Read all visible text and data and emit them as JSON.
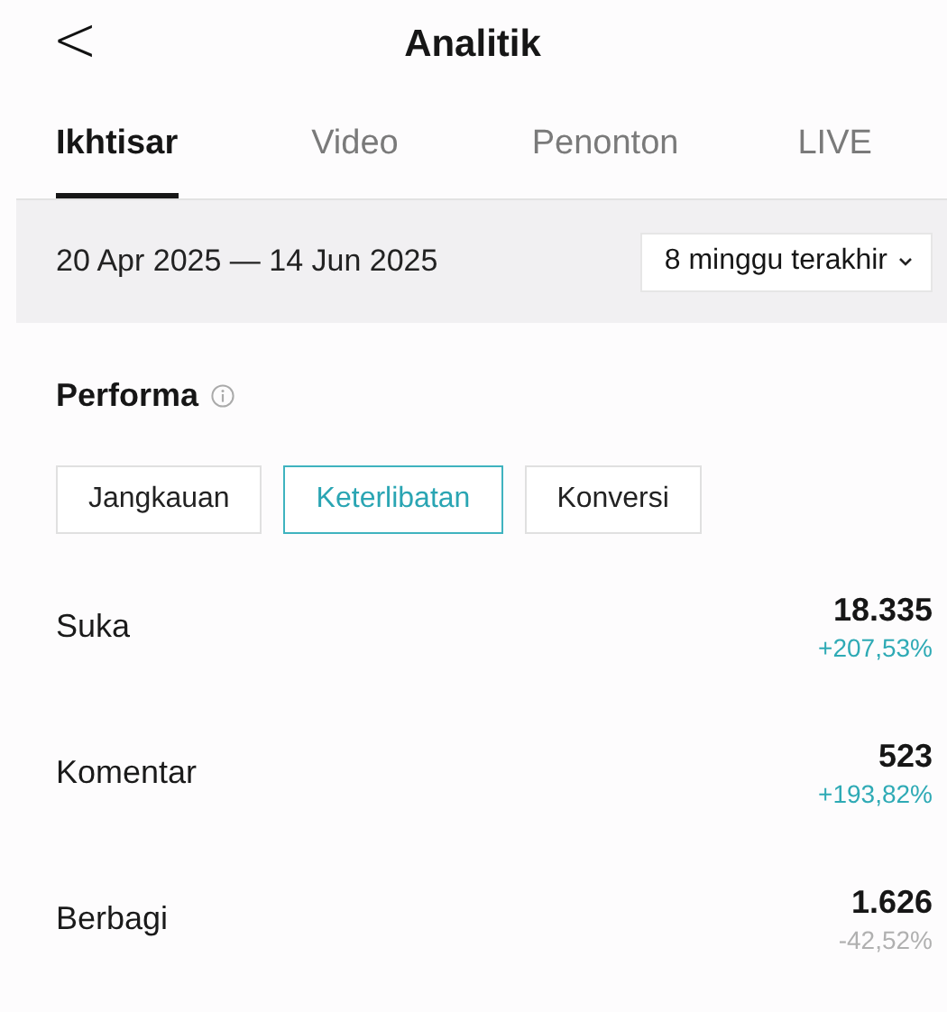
{
  "header": {
    "back": "<",
    "title": "Analitik"
  },
  "tabs": [
    {
      "label": "Ikhtisar",
      "selected": true
    },
    {
      "label": "Video",
      "selected": false
    },
    {
      "label": "Penonton",
      "selected": false
    },
    {
      "label": "LIVE",
      "selected": false
    }
  ],
  "date_range": {
    "text": "20 Apr 2025 — 14 Jun 2025",
    "period": "8 minggu terakhir"
  },
  "section": {
    "title": "Performa"
  },
  "filters": [
    {
      "label": "Jangkauan",
      "selected": false
    },
    {
      "label": "Keterlibatan",
      "selected": true
    },
    {
      "label": "Konversi",
      "selected": false
    }
  ],
  "metrics": [
    {
      "name": "Suka",
      "value": "18.335",
      "change": "+207,53%",
      "color": "#2eaab5"
    },
    {
      "name": "Komentar",
      "value": "523",
      "change": "+193,82%",
      "color": "#2eaab5"
    },
    {
      "name": "Berbagi",
      "value": "1.626",
      "change": "-42,52%",
      "color": "#b0b0b0"
    }
  ]
}
